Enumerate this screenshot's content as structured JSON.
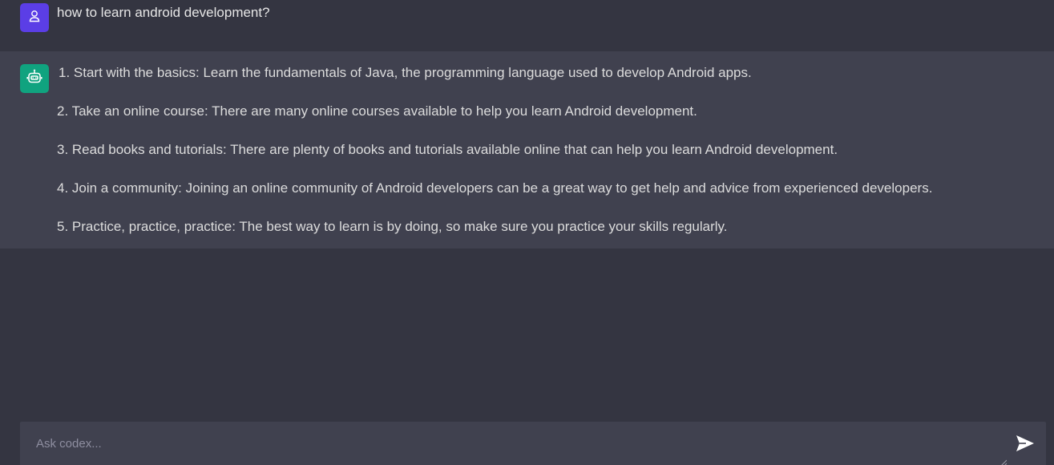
{
  "conversation": {
    "user_message": {
      "avatar_icon": "user-icon",
      "text": "how to learn android development?"
    },
    "bot_message": {
      "avatar_icon": "bot-icon",
      "lines": [
        "1. Start with the basics: Learn the fundamentals of Java, the programming language used to develop Android apps.",
        "2. Take an online course: There are many online courses available to help you learn Android development.",
        "3. Read books and tutorials: There are plenty of books and tutorials available online that can help you learn Android development.",
        "4. Join a community: Joining an online community of Android developers can be a great way to get help and advice from experienced developers.",
        "5. Practice, practice, practice: The best way to learn is by doing, so make sure you practice your skills regularly."
      ]
    }
  },
  "composer": {
    "placeholder": "Ask codex...",
    "value": "",
    "send_icon": "send-icon"
  },
  "colors": {
    "background": "#343541",
    "bot_row": "#40414f",
    "user_avatar": "#5b3ee6",
    "bot_avatar": "#10a37f"
  }
}
